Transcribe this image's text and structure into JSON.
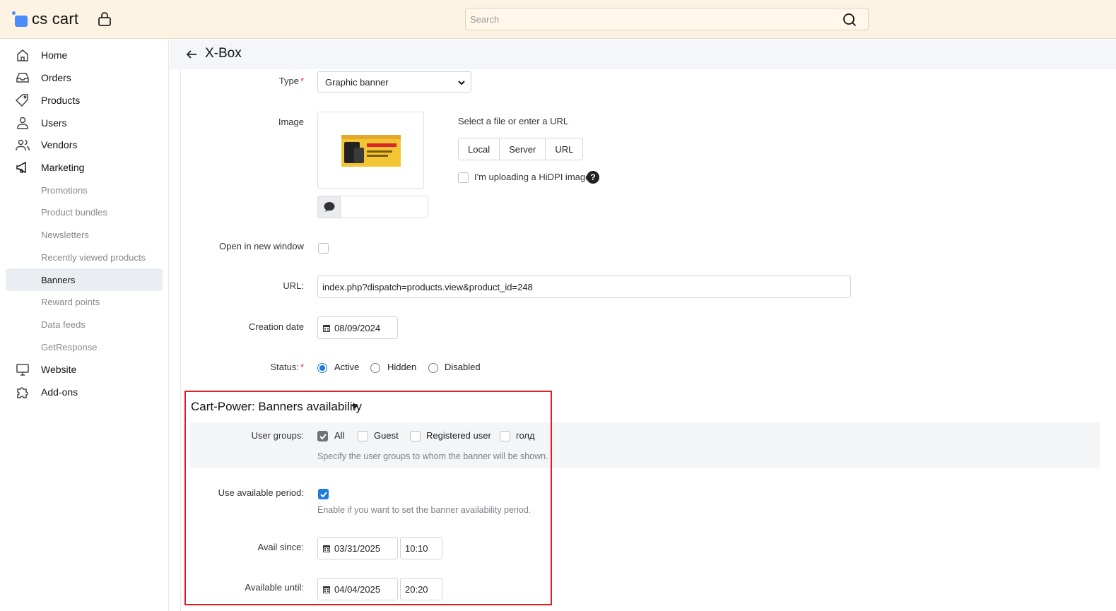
{
  "header": {
    "logo_text": "cs cart",
    "search_placeholder": "Search"
  },
  "sidebar": {
    "items": [
      {
        "label": "Home",
        "icon": "home-icon"
      },
      {
        "label": "Orders",
        "icon": "inbox-icon"
      },
      {
        "label": "Products",
        "icon": "tag-icon"
      },
      {
        "label": "Users",
        "icon": "user-icon"
      },
      {
        "label": "Vendors",
        "icon": "users-icon"
      },
      {
        "label": "Marketing",
        "icon": "megaphone-icon"
      }
    ],
    "sub_items": [
      {
        "label": "Promotions"
      },
      {
        "label": "Product bundles"
      },
      {
        "label": "Newsletters"
      },
      {
        "label": "Recently viewed products"
      },
      {
        "label": "Banners",
        "active": true
      },
      {
        "label": "Reward points"
      },
      {
        "label": "Data feeds"
      },
      {
        "label": "GetResponse"
      }
    ],
    "bottom_items": [
      {
        "label": "Website",
        "icon": "monitor-icon"
      },
      {
        "label": "Add-ons",
        "icon": "puzzle-icon"
      }
    ]
  },
  "page": {
    "title": "X-Box"
  },
  "form": {
    "type_label": "Type",
    "type_value": "Graphic banner",
    "image_label": "Image",
    "select_file_text": "Select a file or enter a URL",
    "source_buttons": [
      "Local",
      "Server",
      "URL"
    ],
    "hidpi_label": "I'm uploading a HiDPI image.",
    "help_glyph": "?",
    "open_new_window_label": "Open in new window",
    "url_label": "URL:",
    "url_value": "index.php?dispatch=products.view&product_id=248",
    "creation_date_label": "Creation date",
    "creation_date_value": "08/09/2024",
    "status_label": "Status:",
    "status_options": [
      "Active",
      "Hidden",
      "Disabled"
    ],
    "status_selected": "Active"
  },
  "availability": {
    "section_title": "Cart-Power: Banners availability",
    "user_groups_label": "User groups:",
    "user_groups": [
      {
        "label": "All",
        "checked": true
      },
      {
        "label": "Guest",
        "checked": false
      },
      {
        "label": "Registered user",
        "checked": false
      },
      {
        "label": "голд",
        "checked": false
      }
    ],
    "user_groups_help": "Specify the user groups to whom the banner will be shown.",
    "use_period_label": "Use available period:",
    "use_period_checked": true,
    "use_period_help": "Enable if you want to set the banner availability period.",
    "avail_since_label": "Avail since:",
    "avail_since_date": "03/31/2025",
    "avail_since_time": "10:10",
    "avail_until_label": "Available until:",
    "avail_until_date": "04/04/2025",
    "avail_until_time": "20:20"
  },
  "colors": {
    "topbar_bg": "#fdf3e3",
    "accent_blue": "#1f7ae0",
    "highlight_red": "#e01b24",
    "required_red": "#d9263a"
  }
}
